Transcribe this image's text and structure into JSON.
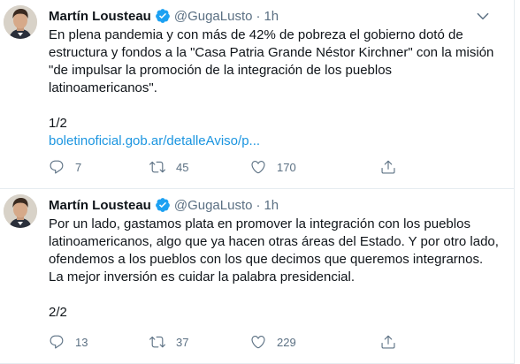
{
  "tweets": [
    {
      "name": "Martín Lousteau",
      "handle": "@GugaLusto",
      "separator": "·",
      "time": "1h",
      "text_lines": [
        "En plena pandemia y con más de 42% de pobreza el gobierno dotó de",
        "estructura y fondos a la \"Casa Patria Grande Néstor Kirchner\" con la misión",
        "\"de impulsar la promoción de la integración de los pueblos",
        "latinoamericanos\"."
      ],
      "thread_marker": "1/2",
      "link": "boletinoficial.gob.ar/detalleAviso/p...",
      "replies": "7",
      "retweets": "45",
      "likes": "170"
    },
    {
      "name": "Martín Lousteau",
      "handle": "@GugaLusto",
      "separator": "·",
      "time": "1h",
      "text_lines": [
        "Por un lado, gastamos plata en promover la integración con los pueblos",
        "latinoamericanos, algo que ya hacen otras áreas del Estado. Y por otro lado,",
        "ofendemos a los pueblos con los que decimos que queremos integrarnos.",
        "La mejor inversión es cuidar la palabra presidencial."
      ],
      "thread_marker": "2/2",
      "replies": "13",
      "retweets": "37",
      "likes": "229"
    }
  ],
  "icons": {
    "verified": "verified-badge-icon",
    "caret": "chevron-down-icon",
    "reply": "reply-icon",
    "retweet": "retweet-icon",
    "like": "heart-icon",
    "share": "share-icon"
  },
  "colors": {
    "verified": "#1da1f2",
    "link": "#1b95e0",
    "secondary_text": "#5b7083",
    "border": "#e6ecf0"
  }
}
